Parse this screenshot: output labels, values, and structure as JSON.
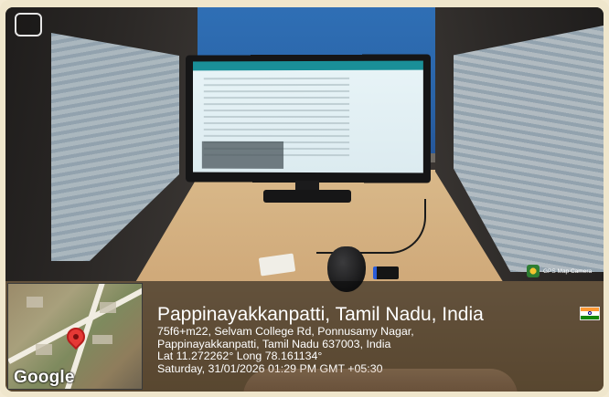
{
  "photo": {
    "description_icons": [
      "monitor-icon",
      "mouse-icon",
      "map-pin-icon",
      "flag-icon"
    ]
  },
  "gps_overlay": {
    "app_badge": "GPS Map Camera",
    "map_logo": "Google",
    "title": "Pappinayakkanpatti, Tamil Nadu, India",
    "address_line1": "75f6+m22, Selvam College Rd, Ponnusamy Nagar,",
    "address_line2": "Pappinayakkanpatti, Tamil Nadu 637003, India",
    "coordinates": "Lat 11.272262° Long 78.161134°",
    "datetime": "Saturday, 31/01/2026 01:29 PM GMT +05:30",
    "flag_colors": {
      "saffron": "#ff9933",
      "white": "#ffffff",
      "green": "#138808",
      "chakra": "#000080"
    },
    "pin_color": "#e53935"
  }
}
